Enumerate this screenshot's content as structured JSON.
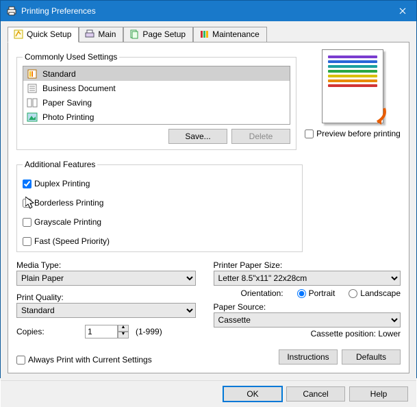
{
  "window": {
    "title": "Printing Preferences"
  },
  "tabs": {
    "quick_setup": "Quick Setup",
    "main": "Main",
    "page_setup": "Page Setup",
    "maintenance": "Maintenance"
  },
  "commonly_used": {
    "legend": "Commonly Used Settings",
    "items": [
      {
        "label": "Standard"
      },
      {
        "label": "Business Document"
      },
      {
        "label": "Paper Saving"
      },
      {
        "label": "Photo Printing"
      }
    ],
    "save": "Save...",
    "delete": "Delete"
  },
  "preview": {
    "checkbox": "Preview before printing"
  },
  "additional": {
    "legend": "Additional Features",
    "duplex": "Duplex Printing",
    "borderless": "Borderless Printing",
    "grayscale": "Grayscale Printing",
    "fast": "Fast (Speed Priority)"
  },
  "media": {
    "label": "Media Type:",
    "value": "Plain Paper"
  },
  "quality": {
    "label": "Print Quality:",
    "value": "Standard"
  },
  "copies": {
    "label": "Copies:",
    "value": "1",
    "range": "(1-999)"
  },
  "paper_size": {
    "label": "Printer Paper Size:",
    "value": "Letter 8.5\"x11\" 22x28cm"
  },
  "orientation": {
    "label": "Orientation:",
    "portrait": "Portrait",
    "landscape": "Landscape"
  },
  "paper_source": {
    "label": "Paper Source:",
    "value": "Cassette",
    "position": "Cassette position: Lower"
  },
  "always_print": "Always Print with Current Settings",
  "buttons": {
    "instructions": "Instructions",
    "defaults": "Defaults",
    "ok": "OK",
    "cancel": "Cancel",
    "help": "Help"
  }
}
